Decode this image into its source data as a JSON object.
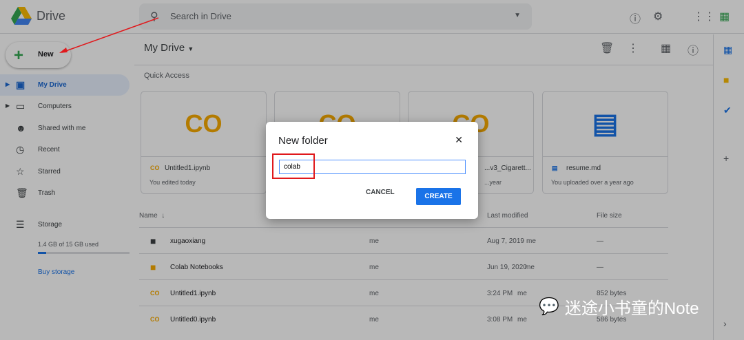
{
  "header": {
    "brand": "Drive",
    "search_placeholder": "Search in Drive"
  },
  "sidebar": {
    "new_label": "New",
    "items": [
      {
        "label": "My Drive"
      },
      {
        "label": "Computers"
      },
      {
        "label": "Shared with me"
      },
      {
        "label": "Recent"
      },
      {
        "label": "Starred"
      },
      {
        "label": "Trash"
      }
    ],
    "storage_label": "Storage",
    "storage_used": "1.4 GB of 15 GB used",
    "storage_fraction": 0.09,
    "buy_storage": "Buy storage"
  },
  "main": {
    "title": "My Drive",
    "quick_access": "Quick Access",
    "cards": [
      {
        "name": "Untitled1.ipynb",
        "sub": "You edited today",
        "thumb": "CO"
      },
      {
        "name": "",
        "sub": "",
        "thumb": "CO"
      },
      {
        "name": "...v3_Cigarett...",
        "sub": "...year",
        "thumb": "CO"
      },
      {
        "name": "resume.md",
        "sub": "You uploaded over a year ago",
        "thumb": ""
      }
    ],
    "columns": {
      "name": "Name",
      "last_modified": "Last modified",
      "size": "File size"
    },
    "rows": [
      {
        "name": "xugaoxiang",
        "owner": "me",
        "modified": "Aug 7, 2019",
        "by": "me",
        "size": "—"
      },
      {
        "name": "Colab Notebooks",
        "owner": "me",
        "modified": "Jun 19, 2020",
        "by": "me",
        "size": "—"
      },
      {
        "name": "Untitled1.ipynb",
        "owner": "me",
        "modified": "3:24 PM",
        "by": "me",
        "size": "852 bytes"
      },
      {
        "name": "Untitled0.ipynb",
        "owner": "me",
        "modified": "3:08 PM",
        "by": "me",
        "size": "586 bytes"
      }
    ]
  },
  "dialog": {
    "title": "New folder",
    "value": "colab",
    "cancel": "CANCEL",
    "create": "CREATE"
  },
  "watermark": "迷途小书童的Note"
}
